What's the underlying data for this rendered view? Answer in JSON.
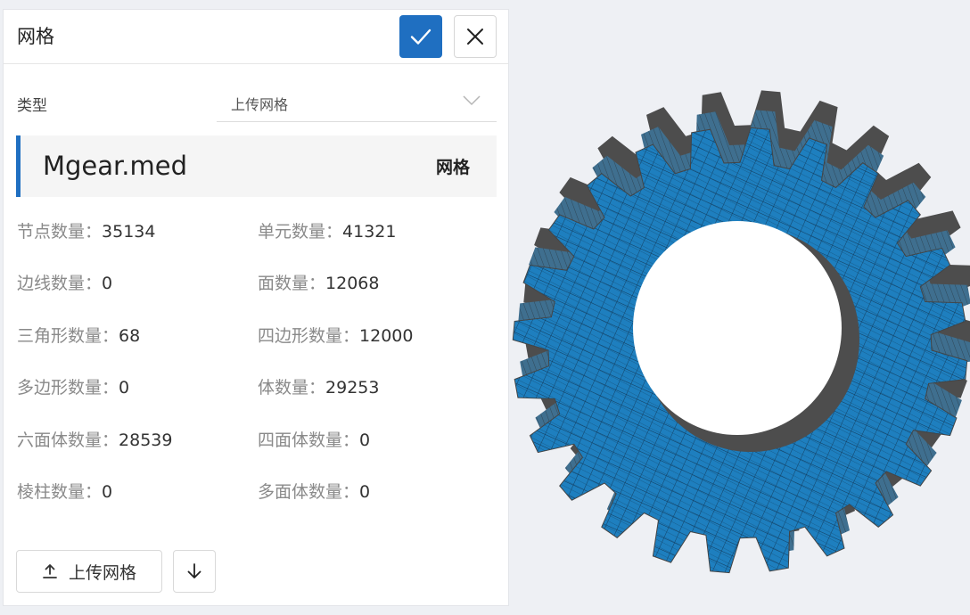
{
  "panel": {
    "title": "网格",
    "confirm_icon": "check-icon",
    "close_icon": "close-icon",
    "accent_color": "#1f6fc1"
  },
  "type_field": {
    "label": "类型",
    "value": "上传网格"
  },
  "file": {
    "name": "Mgear.med",
    "tag": "网格"
  },
  "stats": [
    {
      "label": "节点数量：",
      "value": "35134"
    },
    {
      "label": "单元数量：",
      "value": "41321"
    },
    {
      "label": "边线数量：",
      "value": "0"
    },
    {
      "label": "面数量：",
      "value": "12068"
    },
    {
      "label": "三角形数量：",
      "value": "68"
    },
    {
      "label": "四边形数量：",
      "value": "12000"
    },
    {
      "label": "多边形数量：",
      "value": "0"
    },
    {
      "label": "体数量：",
      "value": "29253"
    },
    {
      "label": "六面体数量：",
      "value": "28539"
    },
    {
      "label": "四面体数量：",
      "value": "0"
    },
    {
      "label": "棱柱数量：",
      "value": "0"
    },
    {
      "label": "多面体数量：",
      "value": "0"
    }
  ],
  "actions": {
    "upload_label": "上传网格",
    "upload_icon": "upload-icon",
    "download_icon": "download-icon"
  },
  "viewport": {
    "mesh_color": "#1e7fbf",
    "side_color": "#4d4d4d"
  }
}
